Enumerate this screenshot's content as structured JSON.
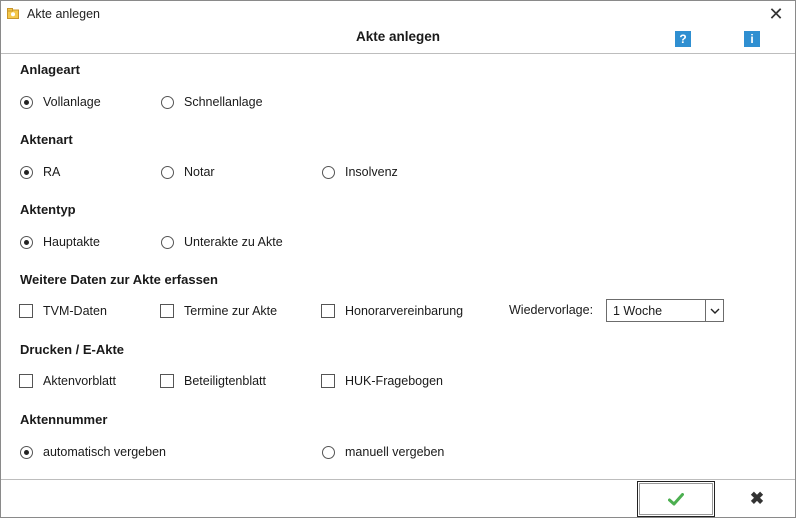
{
  "window": {
    "title": "Akte anlegen",
    "close_symbol": "✕"
  },
  "header": {
    "title": "Akte anlegen",
    "help_symbol": "?",
    "info_symbol": "i"
  },
  "sections": {
    "anlageart": {
      "label": "Anlageart",
      "options": [
        {
          "label": "Vollanlage",
          "checked": true
        },
        {
          "label": "Schnellanlage",
          "checked": false
        }
      ]
    },
    "aktenart": {
      "label": "Aktenart",
      "options": [
        {
          "label": "RA",
          "checked": true
        },
        {
          "label": "Notar",
          "checked": false
        },
        {
          "label": "Insolvenz",
          "checked": false
        }
      ]
    },
    "aktentyp": {
      "label": "Aktentyp",
      "options": [
        {
          "label": "Hauptakte",
          "checked": true
        },
        {
          "label": "Unterakte zu Akte",
          "checked": false
        }
      ]
    },
    "weitere": {
      "label": "Weitere Daten zur Akte erfassen",
      "checkboxes": [
        {
          "label": "TVM-Daten",
          "checked": false
        },
        {
          "label": "Termine zur Akte",
          "checked": false
        },
        {
          "label": "Honorarvereinbarung",
          "checked": false
        }
      ],
      "wiedervorlage_label": "Wiedervorlage:",
      "wiedervorlage_value": "1 Woche"
    },
    "drucken": {
      "label": "Drucken / E-Akte",
      "checkboxes": [
        {
          "label": "Aktenvorblatt",
          "checked": false
        },
        {
          "label": "Beteiligtenblatt",
          "checked": false
        },
        {
          "label": "HUK-Fragebogen",
          "checked": false
        }
      ]
    },
    "aktennummer": {
      "label": "Aktennummer",
      "options": [
        {
          "label": "automatisch vergeben",
          "checked": true
        },
        {
          "label": "manuell vergeben",
          "checked": false
        }
      ]
    }
  },
  "footer": {
    "ok_symbol": "✔",
    "cancel_symbol": "✖"
  },
  "colors": {
    "accent_check": "#4caf50",
    "info_blue": "#2f8fd1"
  }
}
